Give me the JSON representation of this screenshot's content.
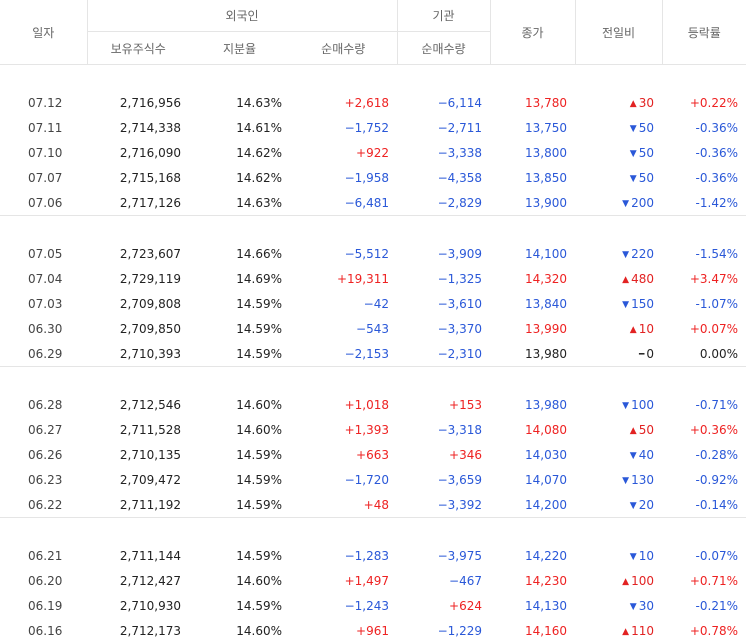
{
  "header": {
    "date": "일자",
    "foreign": "외국인",
    "institution": "기관",
    "close": "종가",
    "change": "전일비",
    "rate": "등락률",
    "holdings": "보유주식수",
    "share": "지분율",
    "foreign_net": "순매수량",
    "inst_net": "순매수량"
  },
  "groups": [
    [
      {
        "date": "07.12",
        "holdings": "2,716,956",
        "share": "14.63%",
        "foreign": "+2,618",
        "inst": "−6,114",
        "close": "13,780",
        "dir": "up",
        "change": "30",
        "rate": "+0.22%"
      },
      {
        "date": "07.11",
        "holdings": "2,714,338",
        "share": "14.61%",
        "foreign": "−1,752",
        "inst": "−2,711",
        "close": "13,750",
        "dir": "down",
        "change": "50",
        "rate": "-0.36%"
      },
      {
        "date": "07.10",
        "holdings": "2,716,090",
        "share": "14.62%",
        "foreign": "+922",
        "inst": "−3,338",
        "close": "13,800",
        "dir": "down",
        "change": "50",
        "rate": "-0.36%"
      },
      {
        "date": "07.07",
        "holdings": "2,715,168",
        "share": "14.62%",
        "foreign": "−1,958",
        "inst": "−4,358",
        "close": "13,850",
        "dir": "down",
        "change": "50",
        "rate": "-0.36%"
      },
      {
        "date": "07.06",
        "holdings": "2,717,126",
        "share": "14.63%",
        "foreign": "−6,481",
        "inst": "−2,829",
        "close": "13,900",
        "dir": "down",
        "change": "200",
        "rate": "-1.42%"
      }
    ],
    [
      {
        "date": "07.05",
        "holdings": "2,723,607",
        "share": "14.66%",
        "foreign": "−5,512",
        "inst": "−3,909",
        "close": "14,100",
        "dir": "down",
        "change": "220",
        "rate": "-1.54%"
      },
      {
        "date": "07.04",
        "holdings": "2,729,119",
        "share": "14.69%",
        "foreign": "+19,311",
        "inst": "−1,325",
        "close": "14,320",
        "dir": "up",
        "change": "480",
        "rate": "+3.47%"
      },
      {
        "date": "07.03",
        "holdings": "2,709,808",
        "share": "14.59%",
        "foreign": "−42",
        "inst": "−3,610",
        "close": "13,840",
        "dir": "down",
        "change": "150",
        "rate": "-1.07%"
      },
      {
        "date": "06.30",
        "holdings": "2,709,850",
        "share": "14.59%",
        "foreign": "−543",
        "inst": "−3,370",
        "close": "13,990",
        "dir": "up",
        "change": "10",
        "rate": "+0.07%"
      },
      {
        "date": "06.29",
        "holdings": "2,710,393",
        "share": "14.59%",
        "foreign": "−2,153",
        "inst": "−2,310",
        "close": "13,980",
        "dir": "flat",
        "change": "0",
        "rate": "0.00%"
      }
    ],
    [
      {
        "date": "06.28",
        "holdings": "2,712,546",
        "share": "14.60%",
        "foreign": "+1,018",
        "inst": "+153",
        "close": "13,980",
        "dir": "down",
        "change": "100",
        "rate": "-0.71%"
      },
      {
        "date": "06.27",
        "holdings": "2,711,528",
        "share": "14.60%",
        "foreign": "+1,393",
        "inst": "−3,318",
        "close": "14,080",
        "dir": "up",
        "change": "50",
        "rate": "+0.36%"
      },
      {
        "date": "06.26",
        "holdings": "2,710,135",
        "share": "14.59%",
        "foreign": "+663",
        "inst": "+346",
        "close": "14,030",
        "dir": "down",
        "change": "40",
        "rate": "-0.28%"
      },
      {
        "date": "06.23",
        "holdings": "2,709,472",
        "share": "14.59%",
        "foreign": "−1,720",
        "inst": "−3,659",
        "close": "14,070",
        "dir": "down",
        "change": "130",
        "rate": "-0.92%"
      },
      {
        "date": "06.22",
        "holdings": "2,711,192",
        "share": "14.59%",
        "foreign": "+48",
        "inst": "−3,392",
        "close": "14,200",
        "dir": "down",
        "change": "20",
        "rate": "-0.14%"
      }
    ],
    [
      {
        "date": "06.21",
        "holdings": "2,711,144",
        "share": "14.59%",
        "foreign": "−1,283",
        "inst": "−3,975",
        "close": "14,220",
        "dir": "down",
        "change": "10",
        "rate": "-0.07%"
      },
      {
        "date": "06.20",
        "holdings": "2,712,427",
        "share": "14.60%",
        "foreign": "+1,497",
        "inst": "−467",
        "close": "14,230",
        "dir": "up",
        "change": "100",
        "rate": "+0.71%"
      },
      {
        "date": "06.19",
        "holdings": "2,710,930",
        "share": "14.59%",
        "foreign": "−1,243",
        "inst": "+624",
        "close": "14,130",
        "dir": "down",
        "change": "30",
        "rate": "-0.21%"
      },
      {
        "date": "06.16",
        "holdings": "2,712,173",
        "share": "14.60%",
        "foreign": "+961",
        "inst": "−1,229",
        "close": "14,160",
        "dir": "up",
        "change": "110",
        "rate": "+0.78%"
      }
    ]
  ],
  "colors": {
    "up": "#e22222",
    "down": "#2a58d8",
    "neutral": "#222222"
  },
  "icons": {
    "up": "triangle-up-icon",
    "down": "triangle-down-icon",
    "flat": "dash-icon"
  }
}
